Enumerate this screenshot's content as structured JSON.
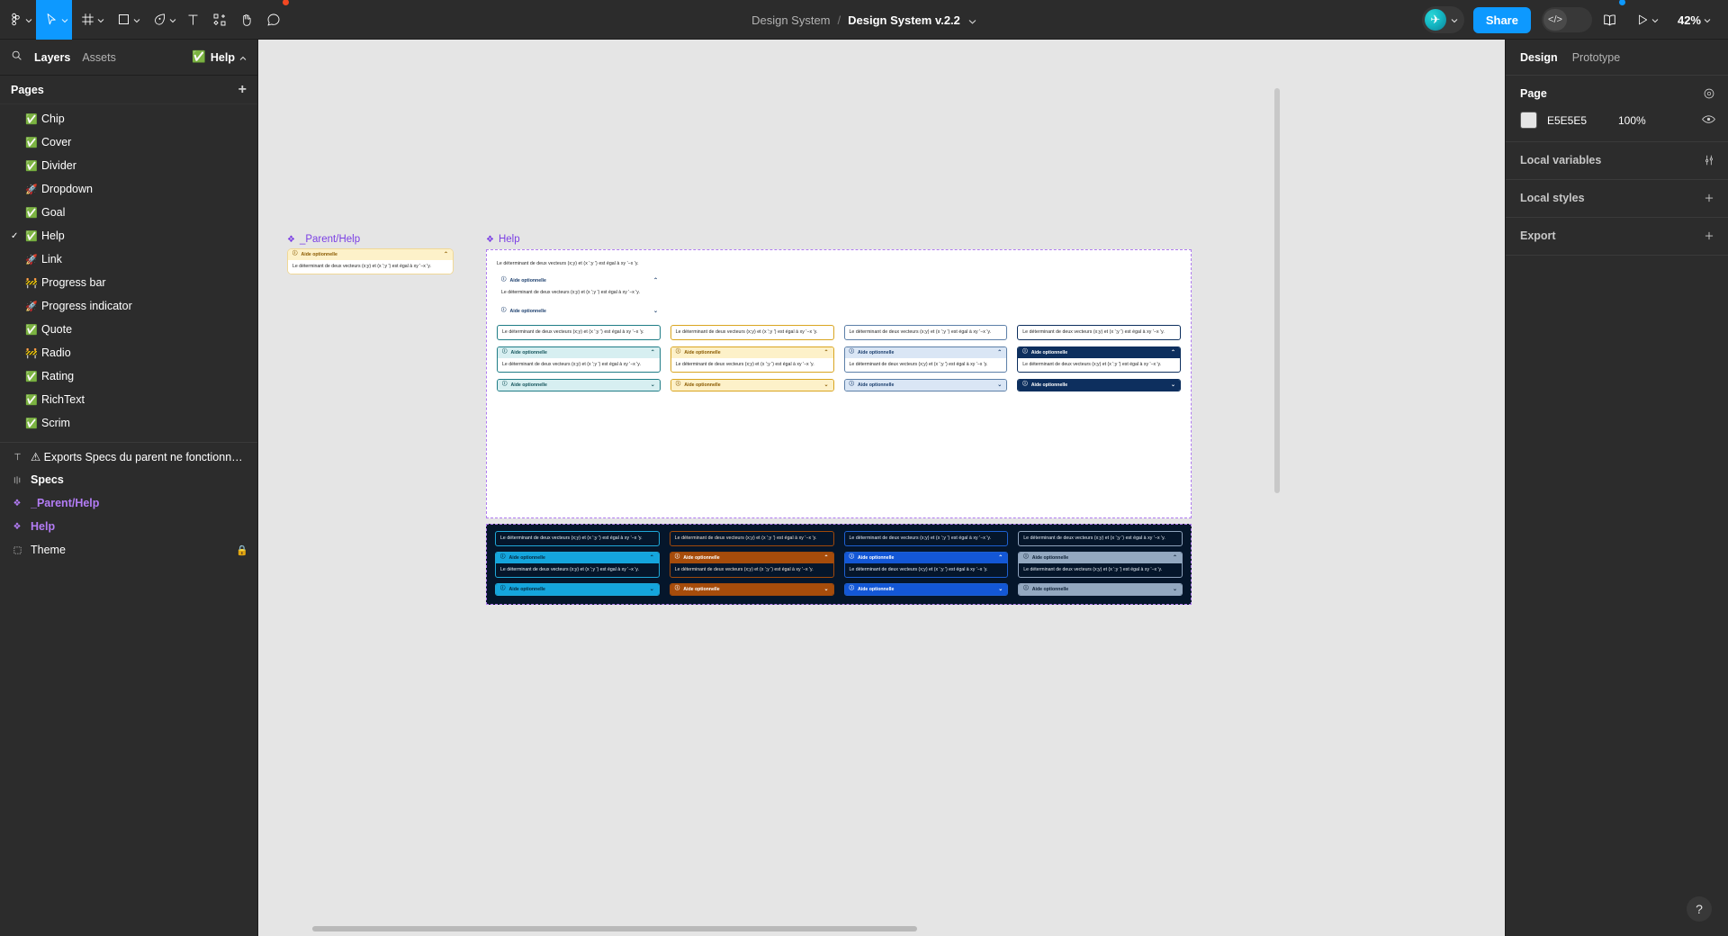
{
  "toolbar": {
    "menu_icon": "figma-logo-icon",
    "tools": [
      {
        "name": "move-tool",
        "icon": "cursor-icon",
        "active": true
      },
      {
        "name": "frame-tool",
        "icon": "frame-icon",
        "active": false
      },
      {
        "name": "shape-tool",
        "icon": "square-icon",
        "active": false
      },
      {
        "name": "pen-tool",
        "icon": "pen-icon",
        "active": false
      },
      {
        "name": "text-tool",
        "icon": "text-icon",
        "active": false
      },
      {
        "name": "resources-tool",
        "icon": "components-icon",
        "active": false
      },
      {
        "name": "hand-tool",
        "icon": "hand-icon",
        "active": false
      },
      {
        "name": "comment-tool",
        "icon": "comment-icon",
        "active": false
      }
    ],
    "breadcrumb_parent": "Design System",
    "breadcrumb_current": "Design System v.2.2",
    "share_label": "Share",
    "devmode_label": "</>",
    "zoom_level": "42%",
    "accent_blue": "#0d99ff"
  },
  "left_panel": {
    "tab_layers": "Layers",
    "tab_assets": "Assets",
    "help_chip": "Help",
    "help_chip_emoji": "✅",
    "pages_title": "Pages",
    "pages": [
      {
        "emoji": "✅",
        "label": "Chip",
        "selected": false
      },
      {
        "emoji": "✅",
        "label": "Cover",
        "selected": false
      },
      {
        "emoji": "✅",
        "label": "Divider",
        "selected": false
      },
      {
        "emoji": "🚀",
        "label": "Dropdown",
        "selected": false
      },
      {
        "emoji": "✅",
        "label": "Goal",
        "selected": false
      },
      {
        "emoji": "✅",
        "label": "Help",
        "selected": true
      },
      {
        "emoji": "🚀",
        "label": "Link",
        "selected": false
      },
      {
        "emoji": "🚧",
        "label": "Progress bar",
        "selected": false
      },
      {
        "emoji": "🚀",
        "label": "Progress indicator",
        "selected": false
      },
      {
        "emoji": "✅",
        "label": "Quote",
        "selected": false
      },
      {
        "emoji": "🚧",
        "label": "Radio",
        "selected": false
      },
      {
        "emoji": "✅",
        "label": "Rating",
        "selected": false
      },
      {
        "emoji": "✅",
        "label": "RichText",
        "selected": false
      },
      {
        "emoji": "✅",
        "label": "Scrim",
        "selected": false
      }
    ],
    "layers": [
      {
        "icon": "text-layer-icon",
        "label": "⚠ Exports Specs du parent ne fonctionne pas",
        "style": "normal",
        "locked": false
      },
      {
        "icon": "section-icon",
        "label": "Specs",
        "style": "bold",
        "locked": false
      },
      {
        "icon": "component-icon",
        "label": "_Parent/Help",
        "style": "purple",
        "locked": false
      },
      {
        "icon": "component-icon",
        "label": "Help",
        "style": "purple",
        "locked": false
      },
      {
        "icon": "frame-layer-icon",
        "label": "Theme",
        "style": "normal",
        "locked": true
      }
    ]
  },
  "right_panel": {
    "tab_design": "Design",
    "tab_prototype": "Prototype",
    "page_title": "Page",
    "page_color_hex": "E5E5E5",
    "page_opacity": "100%",
    "local_variables_title": "Local variables",
    "local_styles_title": "Local styles",
    "export_title": "Export"
  },
  "canvas": {
    "background": "#e5e5e5",
    "frames": [
      {
        "name": "_Parent/Help",
        "label": "_Parent/Help"
      },
      {
        "name": "Help",
        "label": "Help"
      }
    ],
    "accordion_title": "Aide optionnelle",
    "body_text": "Le déterminant de deux vecteurs (x;y) et (x ';y ') est égal à xy '−x 'y.",
    "info_icon": "info-circle-icon",
    "chevron_up": "chevron-up-icon",
    "chevron_down": "chevron-down-icon",
    "light_variants": [
      {
        "name": "teal",
        "border": "#1f7d86",
        "head_bg": "#d7eff1",
        "head_fg": "#15555c",
        "body_fg": "#1e1e1e",
        "card_bg": "#ffffff"
      },
      {
        "name": "amber",
        "border": "#d9a520",
        "head_bg": "#fdf1c9",
        "head_fg": "#8a5a00",
        "body_fg": "#1e1e1e",
        "card_bg": "#ffffff"
      },
      {
        "name": "blue",
        "border": "#5c7fa8",
        "head_bg": "#dae6f5",
        "head_fg": "#1c3f6e",
        "body_fg": "#1e1e1e",
        "card_bg": "#ffffff"
      },
      {
        "name": "navy",
        "border": "#0d2f5e",
        "head_bg": "#0d2f5e",
        "head_fg": "#ffffff",
        "body_fg": "#1e1e1e",
        "card_bg": "#ffffff"
      }
    ],
    "dark_variants": [
      {
        "name": "cyan",
        "border": "#1fa8d8",
        "head_bg": "#14a5dd",
        "head_fg": "#06283d",
        "body_fg": "#e8f4fb",
        "card_bg": "#05162b"
      },
      {
        "name": "orange",
        "border": "#a0490a",
        "head_bg": "#a64c0b",
        "head_fg": "#ffffff",
        "body_fg": "#f2e4d8",
        "card_bg": "#05162b"
      },
      {
        "name": "blue",
        "border": "#1d5fd0",
        "head_bg": "#1357d6",
        "head_fg": "#ffffff",
        "body_fg": "#e3ecfb",
        "card_bg": "#05162b"
      },
      {
        "name": "slate",
        "border": "#8fa3bd",
        "head_bg": "#93a8c0",
        "head_fg": "#0d2036",
        "body_fg": "#e6edf5",
        "card_bg": "#05162b"
      }
    ],
    "plain_rows": [
      {
        "type": "text_only"
      },
      {
        "type": "accordion_open"
      },
      {
        "type": "accordion_closed"
      }
    ]
  },
  "help_fab": "?"
}
